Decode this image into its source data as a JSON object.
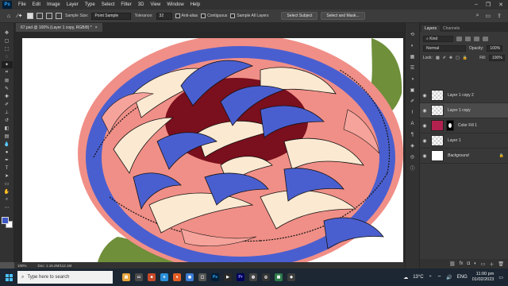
{
  "menubar": {
    "logo": "Ps",
    "items": [
      "File",
      "Edit",
      "Image",
      "Layer",
      "Type",
      "Select",
      "Filter",
      "3D",
      "View",
      "Window",
      "Help"
    ],
    "window_controls": [
      "–",
      "❐",
      "✕"
    ]
  },
  "options": {
    "sample_size_label": "Sample Size:",
    "sample_size_value": "Point Sample",
    "tolerance_label": "Tolerance:",
    "tolerance_value": "32",
    "anti_alias_label": "Anti-alias",
    "contiguous_label": "Contiguous",
    "sample_all_label": "Sample All Layers",
    "select_subject_label": "Select Subject",
    "select_mask_label": "Select and Mask..."
  },
  "document": {
    "tab_title": "67.psd @ 100% (Layer 1 copy, RGB/8) *",
    "close": "×"
  },
  "status": {
    "zoom": "100%",
    "doc_size": "Doc: 1.16.2M/112.1M"
  },
  "layers_panel": {
    "tabs": [
      "Layers",
      "Channels"
    ],
    "kind_label": "Kind",
    "blend_mode": "Normal",
    "opacity_label": "Opacity:",
    "opacity_value": "100%",
    "lock_label": "Lock:",
    "fill_label": "Fill:",
    "fill_value": "100%",
    "layers": [
      {
        "name": "Layer 1 copy 2",
        "thumb": "checker",
        "selected": false,
        "italic": false
      },
      {
        "name": "Layer 1 copy",
        "thumb": "checker",
        "selected": true,
        "italic": false
      },
      {
        "name": "Color Fill 1",
        "thumb": "fill",
        "selected": false,
        "italic": false
      },
      {
        "name": "Layer 1",
        "thumb": "checker",
        "selected": false,
        "italic": false
      },
      {
        "name": "Background",
        "thumb": "white",
        "selected": false,
        "italic": true
      }
    ]
  },
  "taskbar": {
    "search_placeholder": "Type here to search",
    "weather": "13°C",
    "language": "ENG",
    "time": "11:00 pm",
    "date": "01/02/2023"
  },
  "colors": {
    "foreground": "#3e57c4",
    "background": "#ffffff",
    "flower_blue": "#4a5fcf",
    "flower_pink": "#f08f87",
    "flower_cream": "#fce9d2",
    "flower_maroon": "#7a0f1d",
    "leaf_green": "#6f8f3a"
  }
}
